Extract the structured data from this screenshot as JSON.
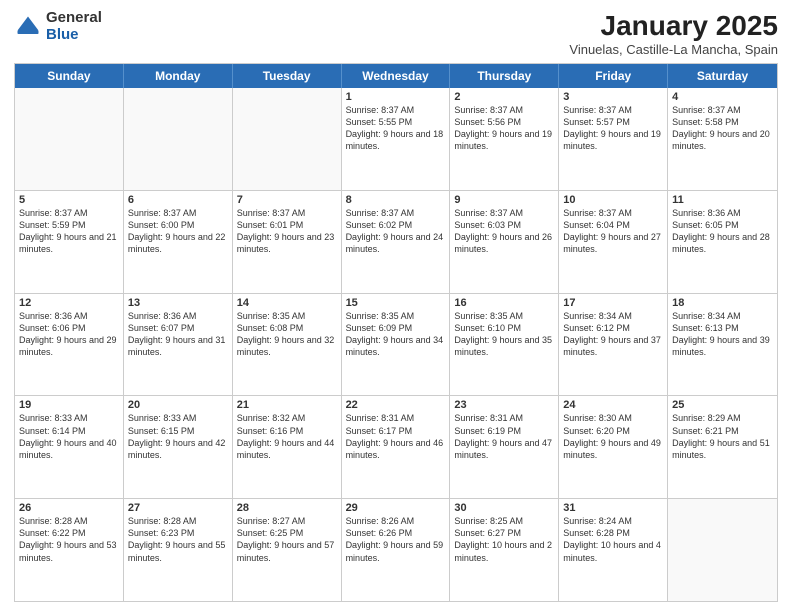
{
  "logo": {
    "general": "General",
    "blue": "Blue"
  },
  "header": {
    "month": "January 2025",
    "location": "Vinuelas, Castille-La Mancha, Spain"
  },
  "dayHeaders": [
    "Sunday",
    "Monday",
    "Tuesday",
    "Wednesday",
    "Thursday",
    "Friday",
    "Saturday"
  ],
  "weeks": [
    [
      {
        "day": "",
        "empty": true
      },
      {
        "day": "",
        "empty": true
      },
      {
        "day": "",
        "empty": true
      },
      {
        "day": "1",
        "sunrise": "8:37 AM",
        "sunset": "5:55 PM",
        "daylight": "9 hours and 18 minutes."
      },
      {
        "day": "2",
        "sunrise": "8:37 AM",
        "sunset": "5:56 PM",
        "daylight": "9 hours and 19 minutes."
      },
      {
        "day": "3",
        "sunrise": "8:37 AM",
        "sunset": "5:57 PM",
        "daylight": "9 hours and 19 minutes."
      },
      {
        "day": "4",
        "sunrise": "8:37 AM",
        "sunset": "5:58 PM",
        "daylight": "9 hours and 20 minutes."
      }
    ],
    [
      {
        "day": "5",
        "sunrise": "8:37 AM",
        "sunset": "5:59 PM",
        "daylight": "9 hours and 21 minutes."
      },
      {
        "day": "6",
        "sunrise": "8:37 AM",
        "sunset": "6:00 PM",
        "daylight": "9 hours and 22 minutes."
      },
      {
        "day": "7",
        "sunrise": "8:37 AM",
        "sunset": "6:01 PM",
        "daylight": "9 hours and 23 minutes."
      },
      {
        "day": "8",
        "sunrise": "8:37 AM",
        "sunset": "6:02 PM",
        "daylight": "9 hours and 24 minutes."
      },
      {
        "day": "9",
        "sunrise": "8:37 AM",
        "sunset": "6:03 PM",
        "daylight": "9 hours and 26 minutes."
      },
      {
        "day": "10",
        "sunrise": "8:37 AM",
        "sunset": "6:04 PM",
        "daylight": "9 hours and 27 minutes."
      },
      {
        "day": "11",
        "sunrise": "8:36 AM",
        "sunset": "6:05 PM",
        "daylight": "9 hours and 28 minutes."
      }
    ],
    [
      {
        "day": "12",
        "sunrise": "8:36 AM",
        "sunset": "6:06 PM",
        "daylight": "9 hours and 29 minutes."
      },
      {
        "day": "13",
        "sunrise": "8:36 AM",
        "sunset": "6:07 PM",
        "daylight": "9 hours and 31 minutes."
      },
      {
        "day": "14",
        "sunrise": "8:35 AM",
        "sunset": "6:08 PM",
        "daylight": "9 hours and 32 minutes."
      },
      {
        "day": "15",
        "sunrise": "8:35 AM",
        "sunset": "6:09 PM",
        "daylight": "9 hours and 34 minutes."
      },
      {
        "day": "16",
        "sunrise": "8:35 AM",
        "sunset": "6:10 PM",
        "daylight": "9 hours and 35 minutes."
      },
      {
        "day": "17",
        "sunrise": "8:34 AM",
        "sunset": "6:12 PM",
        "daylight": "9 hours and 37 minutes."
      },
      {
        "day": "18",
        "sunrise": "8:34 AM",
        "sunset": "6:13 PM",
        "daylight": "9 hours and 39 minutes."
      }
    ],
    [
      {
        "day": "19",
        "sunrise": "8:33 AM",
        "sunset": "6:14 PM",
        "daylight": "9 hours and 40 minutes."
      },
      {
        "day": "20",
        "sunrise": "8:33 AM",
        "sunset": "6:15 PM",
        "daylight": "9 hours and 42 minutes."
      },
      {
        "day": "21",
        "sunrise": "8:32 AM",
        "sunset": "6:16 PM",
        "daylight": "9 hours and 44 minutes."
      },
      {
        "day": "22",
        "sunrise": "8:31 AM",
        "sunset": "6:17 PM",
        "daylight": "9 hours and 46 minutes."
      },
      {
        "day": "23",
        "sunrise": "8:31 AM",
        "sunset": "6:19 PM",
        "daylight": "9 hours and 47 minutes."
      },
      {
        "day": "24",
        "sunrise": "8:30 AM",
        "sunset": "6:20 PM",
        "daylight": "9 hours and 49 minutes."
      },
      {
        "day": "25",
        "sunrise": "8:29 AM",
        "sunset": "6:21 PM",
        "daylight": "9 hours and 51 minutes."
      }
    ],
    [
      {
        "day": "26",
        "sunrise": "8:28 AM",
        "sunset": "6:22 PM",
        "daylight": "9 hours and 53 minutes."
      },
      {
        "day": "27",
        "sunrise": "8:28 AM",
        "sunset": "6:23 PM",
        "daylight": "9 hours and 55 minutes."
      },
      {
        "day": "28",
        "sunrise": "8:27 AM",
        "sunset": "6:25 PM",
        "daylight": "9 hours and 57 minutes."
      },
      {
        "day": "29",
        "sunrise": "8:26 AM",
        "sunset": "6:26 PM",
        "daylight": "9 hours and 59 minutes."
      },
      {
        "day": "30",
        "sunrise": "8:25 AM",
        "sunset": "6:27 PM",
        "daylight": "10 hours and 2 minutes."
      },
      {
        "day": "31",
        "sunrise": "8:24 AM",
        "sunset": "6:28 PM",
        "daylight": "10 hours and 4 minutes."
      },
      {
        "day": "",
        "empty": true
      }
    ]
  ]
}
